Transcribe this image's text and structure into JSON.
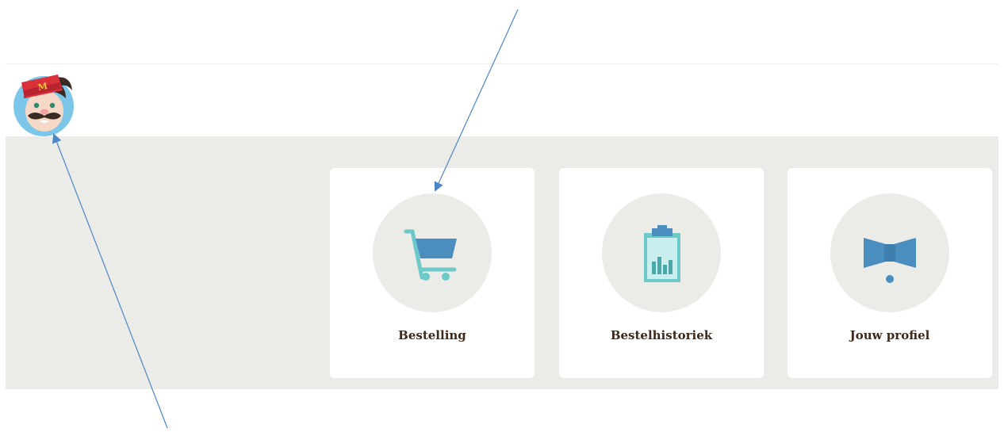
{
  "header": {
    "logo_icon": "mascot-logo-icon",
    "logo_letter": "M"
  },
  "cards": [
    {
      "label": "Bestelling",
      "icon": "cart-icon"
    },
    {
      "label": "Bestelhistoriek",
      "icon": "clipboard-chart-icon"
    },
    {
      "label": "Jouw profiel",
      "icon": "bow-tie-icon"
    }
  ],
  "colors": {
    "panel_bg": "#ebebe8",
    "card_bg": "#ffffff",
    "label": "#3d2a1c",
    "icon_blue": "#4a8ec0",
    "icon_teal": "#6dc9c9",
    "mascot_blue": "#7cc6ea",
    "mascot_hat": "#d9303a",
    "annotation_arrow": "#4a86c8"
  },
  "annotations": [
    {
      "name": "arrow-to-bestelling"
    },
    {
      "name": "arrow-to-logo"
    }
  ]
}
